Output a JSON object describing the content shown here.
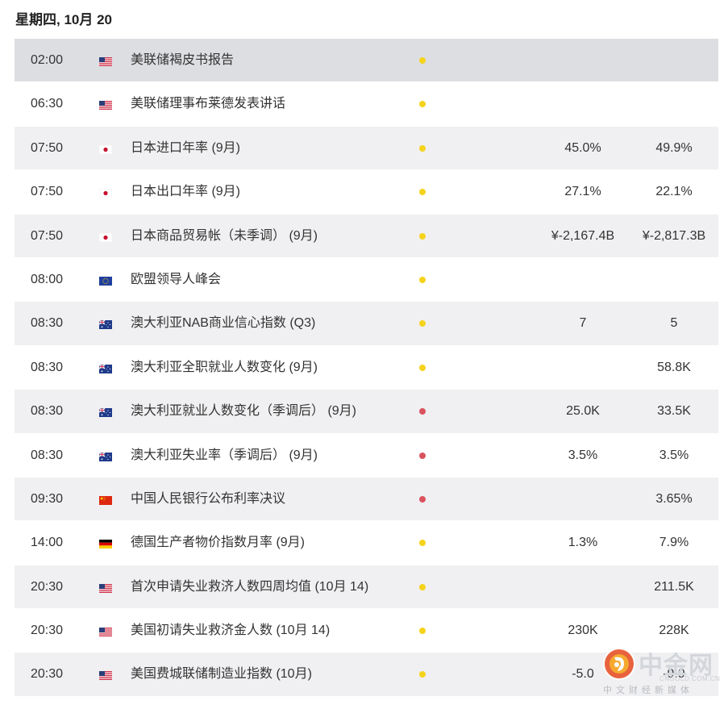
{
  "date_header": "星期四, 10月 20",
  "colors": {
    "yellow_dot": "#f5d31c",
    "red_dot": "#d9535f"
  },
  "rows": [
    {
      "time": "02:00",
      "flag": "us-flag-icon",
      "event": "美联储褐皮书报告",
      "importance": "yellow",
      "actual": "",
      "previous": ""
    },
    {
      "time": "06:30",
      "flag": "us-flag-icon",
      "event": "美联储理事布莱德发表讲话",
      "importance": "yellow",
      "actual": "",
      "previous": ""
    },
    {
      "time": "07:50",
      "flag": "jp-flag-icon",
      "event": "日本进口年率 (9月)",
      "importance": "yellow",
      "actual": "45.0%",
      "previous": "49.9%"
    },
    {
      "time": "07:50",
      "flag": "jp-flag-icon",
      "event": "日本出口年率 (9月)",
      "importance": "yellow",
      "actual": "27.1%",
      "previous": "22.1%"
    },
    {
      "time": "07:50",
      "flag": "jp-flag-icon",
      "event": "日本商品贸易帐（未季调） (9月)",
      "importance": "yellow",
      "actual": "¥-2,167.4B",
      "previous": "¥-2,817.3B"
    },
    {
      "time": "08:00",
      "flag": "eu-flag-icon",
      "event": "欧盟领导人峰会",
      "importance": "yellow",
      "actual": "",
      "previous": ""
    },
    {
      "time": "08:30",
      "flag": "au-flag-icon",
      "event": "澳大利亚NAB商业信心指数 (Q3)",
      "importance": "yellow",
      "actual": "7",
      "previous": "5"
    },
    {
      "time": "08:30",
      "flag": "au-flag-icon",
      "event": "澳大利亚全职就业人数变化 (9月)",
      "importance": "yellow",
      "actual": "",
      "previous": "58.8K"
    },
    {
      "time": "08:30",
      "flag": "au-flag-icon",
      "event": "澳大利亚就业人数变化（季调后） (9月)",
      "importance": "red",
      "actual": "25.0K",
      "previous": "33.5K"
    },
    {
      "time": "08:30",
      "flag": "au-flag-icon",
      "event": "澳大利亚失业率（季调后） (9月)",
      "importance": "red",
      "actual": "3.5%",
      "previous": "3.5%"
    },
    {
      "time": "09:30",
      "flag": "cn-flag-icon",
      "event": "中国人民银行公布利率决议",
      "importance": "red",
      "actual": "",
      "previous": "3.65%"
    },
    {
      "time": "14:00",
      "flag": "de-flag-icon",
      "event": "德国生产者物价指数月率 (9月)",
      "importance": "yellow",
      "actual": "1.3%",
      "previous": "7.9%"
    },
    {
      "time": "20:30",
      "flag": "us-flag-icon",
      "event": "首次申请失业救济人数四周均值 (10月 14)",
      "importance": "yellow",
      "actual": "",
      "previous": "211.5K"
    },
    {
      "time": "20:30",
      "flag": "us-flag-icon",
      "event": "美国初请失业救济金人数 (10月 14)",
      "importance": "yellow",
      "actual": "230K",
      "previous": "228K"
    },
    {
      "time": "20:30",
      "flag": "us-flag-icon",
      "event": "美国费城联储制造业指数 (10月)",
      "importance": "yellow",
      "actual": "-5.0",
      "previous": "-9.9"
    }
  ],
  "watermark": {
    "title": "中金网",
    "url": "CNGOLD.COM.CN",
    "subtitle": "中文财经新媒体"
  }
}
